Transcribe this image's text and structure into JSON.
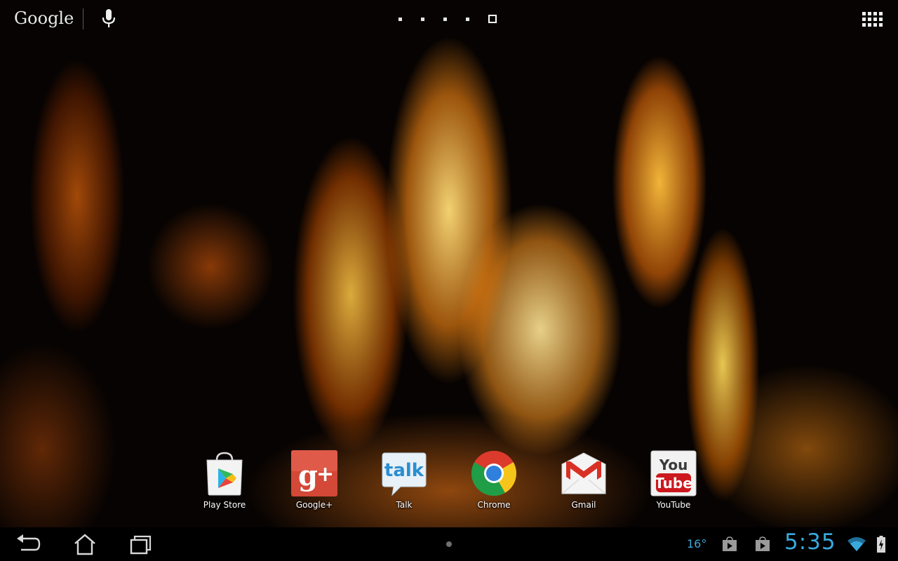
{
  "top_bar": {
    "search_label": "Google",
    "mic_icon": "mic-icon",
    "pages": {
      "count": 5,
      "active_index": 4
    },
    "apps_icon": "apps-grid-icon"
  },
  "hotseat": {
    "apps": [
      {
        "label": "Play Store",
        "icon": "play-store-icon"
      },
      {
        "label": "Google+",
        "icon": "google-plus-icon"
      },
      {
        "label": "Talk",
        "icon": "talk-icon",
        "icon_text": "talk"
      },
      {
        "label": "Chrome",
        "icon": "chrome-icon"
      },
      {
        "label": "Gmail",
        "icon": "gmail-icon"
      },
      {
        "label": "YouTube",
        "icon": "youtube-icon",
        "icon_text_top": "You",
        "icon_text_bottom": "Tube"
      }
    ]
  },
  "nav_bar": {
    "back_icon": "back-icon",
    "home_icon": "home-icon",
    "recents_icon": "recents-icon"
  },
  "status": {
    "weather_temp": "16°",
    "clock": "5:35",
    "wifi_icon": "wifi-icon",
    "battery_icon": "battery-charging-icon"
  },
  "colors": {
    "status_accent": "#39a9dd",
    "google_plus_red": "#d34836",
    "talk_blue": "#2a8fd0",
    "youtube_red": "#cc181e"
  }
}
